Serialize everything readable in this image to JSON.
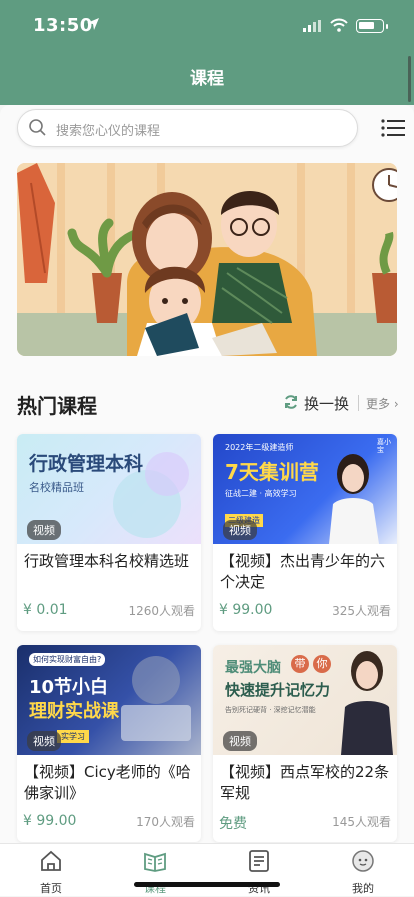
{
  "status": {
    "time": "13:50"
  },
  "header": {
    "title": "课程"
  },
  "search": {
    "placeholder": "搜索您心仪的课程"
  },
  "section": {
    "title": "热门课程",
    "refresh_label": "换一换",
    "more_label": "更多"
  },
  "courses": [
    {
      "title": "行政管理本科名校精选班",
      "price": "¥ 0.01",
      "views": "1260人观看",
      "tag": "视频",
      "thumb": {
        "headline": "行政管理本科",
        "sub": "名校精品班"
      }
    },
    {
      "title": "【视频】杰出青少年的六个决定",
      "price": "¥ 99.00",
      "views": "325人观看",
      "tag": "视频",
      "thumb": {
        "top": "2022年二级建造师",
        "headline": "7天集训营",
        "sub": "征战二建 · 高效学习",
        "badge": "二级建造",
        "person": "嘉小宝"
      }
    },
    {
      "title": "【视频】Cicy老师的《哈佛家训》",
      "price": "¥ 99.00",
      "views": "170人观看",
      "tag": "视频",
      "thumb": {
        "top": "如何实现财富自由?",
        "headline": "10节小白",
        "headline2": "理财实战课",
        "badge": "实学习"
      }
    },
    {
      "title": "【视频】西点军校的22条军规",
      "price": "免费",
      "views": "145人观看",
      "tag": "视频",
      "thumb": {
        "headline": "最强大脑",
        "mark1": "带",
        "mark2": "你",
        "headline2": "快速提升记忆力",
        "sub": "告别死记硬背 · 深挖记忆潜能"
      }
    }
  ],
  "tabs": [
    {
      "label": "首页",
      "icon": "home-icon"
    },
    {
      "label": "课程",
      "icon": "book-icon"
    },
    {
      "label": "资讯",
      "icon": "news-icon"
    },
    {
      "label": "我的",
      "icon": "profile-icon"
    }
  ],
  "colors": {
    "brand": "#5f9c81",
    "price": "#5f9c81"
  }
}
